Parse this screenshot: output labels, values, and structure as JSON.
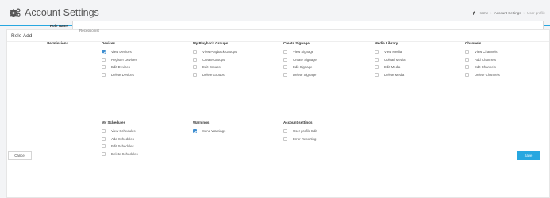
{
  "header": {
    "title": "Account Settings",
    "title_icon": "gears-icon",
    "breadcrumb": [
      "Home",
      "Account Settings",
      "User profile"
    ]
  },
  "panel": {
    "title": "Role Add"
  },
  "form": {
    "role_name_label": "Role Name",
    "role_name_value": "Receptionist",
    "permissions_label": "Permissions"
  },
  "groups": [
    {
      "title": "Devices",
      "items": [
        {
          "label": "View Devices",
          "checked": true
        },
        {
          "label": "Register Devices",
          "checked": false
        },
        {
          "label": "Edit Devices",
          "checked": false
        },
        {
          "label": "Delete Devices",
          "checked": false
        }
      ]
    },
    {
      "title": "My Schedules",
      "items": [
        {
          "label": "View Schedules",
          "checked": false
        },
        {
          "label": "Add Schedules",
          "checked": false
        },
        {
          "label": "Edit Schedules",
          "checked": false
        },
        {
          "label": "Delete Schedules",
          "checked": false
        }
      ]
    },
    {
      "title": "My Playback Groups",
      "items": [
        {
          "label": "View Playback Groups",
          "checked": false
        },
        {
          "label": "Create Groups",
          "checked": false
        },
        {
          "label": "Edit Groups",
          "checked": false
        },
        {
          "label": "Delete Groups",
          "checked": false
        }
      ]
    },
    {
      "title": "Warnings",
      "items": [
        {
          "label": "Send Warnings",
          "checked": true
        }
      ]
    },
    {
      "title": "Create Signage",
      "items": [
        {
          "label": "View Signage",
          "checked": false
        },
        {
          "label": "Create Signage",
          "checked": false
        },
        {
          "label": "Edit Signage",
          "checked": false
        },
        {
          "label": "Delete Signage",
          "checked": false
        }
      ]
    },
    {
      "title": "Account settings",
      "items": [
        {
          "label": "User profile Edit",
          "checked": false
        },
        {
          "label": "Error Reporting",
          "checked": false
        }
      ]
    },
    {
      "title": "Media Library",
      "items": [
        {
          "label": "View Media",
          "checked": false
        },
        {
          "label": "Upload Media",
          "checked": false
        },
        {
          "label": "Edit Media",
          "checked": false
        },
        {
          "label": "Delete Media",
          "checked": false
        }
      ]
    },
    {
      "title": "Channels",
      "items": [
        {
          "label": "View Channels",
          "checked": false
        },
        {
          "label": "Add Channels",
          "checked": false
        },
        {
          "label": "Edit Channels",
          "checked": false
        },
        {
          "label": "Delete Channels",
          "checked": false
        }
      ]
    }
  ],
  "footer": {
    "cancel_label": "Cancel",
    "save_label": "Save"
  },
  "colors": {
    "accent": "#27a7e0",
    "checkbox_checked": "#3e8ed0"
  }
}
